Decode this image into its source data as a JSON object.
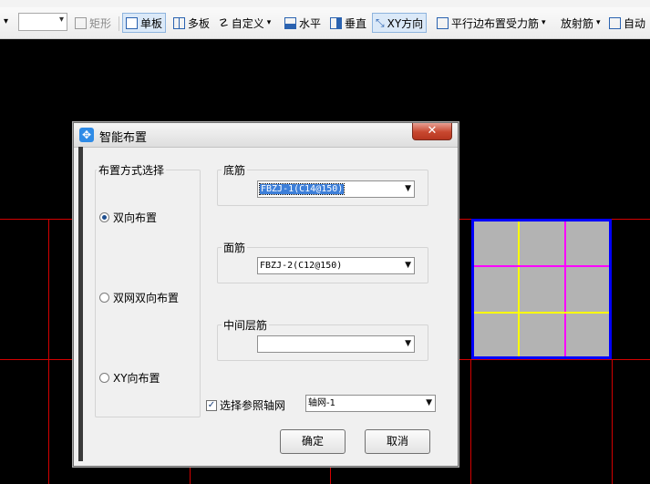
{
  "toolbar": {
    "shape_rect": "矩形",
    "single_board": "单板",
    "multi_board": "多板",
    "custom": "自定义",
    "horizontal": "水平",
    "vertical": "垂直",
    "xy_direction": "XY方向",
    "parallel_edge": "平行边布置受力筋",
    "radial": "放射筋",
    "auto": "自动"
  },
  "dialog": {
    "title": "智能布置",
    "close_glyph": "✕",
    "method_group": {
      "label": "布置方式选择",
      "options": [
        {
          "label": "双向布置",
          "selected": true
        },
        {
          "label": "双网双向布置",
          "selected": false
        },
        {
          "label": "XY向布置",
          "selected": false
        }
      ]
    },
    "bottom_bar": {
      "label": "底筋",
      "value": "FBZJ-1(C14@150)"
    },
    "top_bar": {
      "label": "面筋",
      "value": "FBZJ-2(C12@150)"
    },
    "middle_bar": {
      "label": "中间层筋",
      "value": ""
    },
    "reference_grid": {
      "label": "选择参照轴网",
      "checked": true,
      "value": "轴网-1"
    },
    "ok_label": "确定",
    "cancel_label": "取消"
  },
  "colors": {
    "canvas": "#000000",
    "axis_line": "#d40000",
    "panel_fill": "#b3b3b3",
    "panel_border": "#0000ff",
    "rebar_x": "#ffff00",
    "rebar_y": "#ff00ff"
  }
}
